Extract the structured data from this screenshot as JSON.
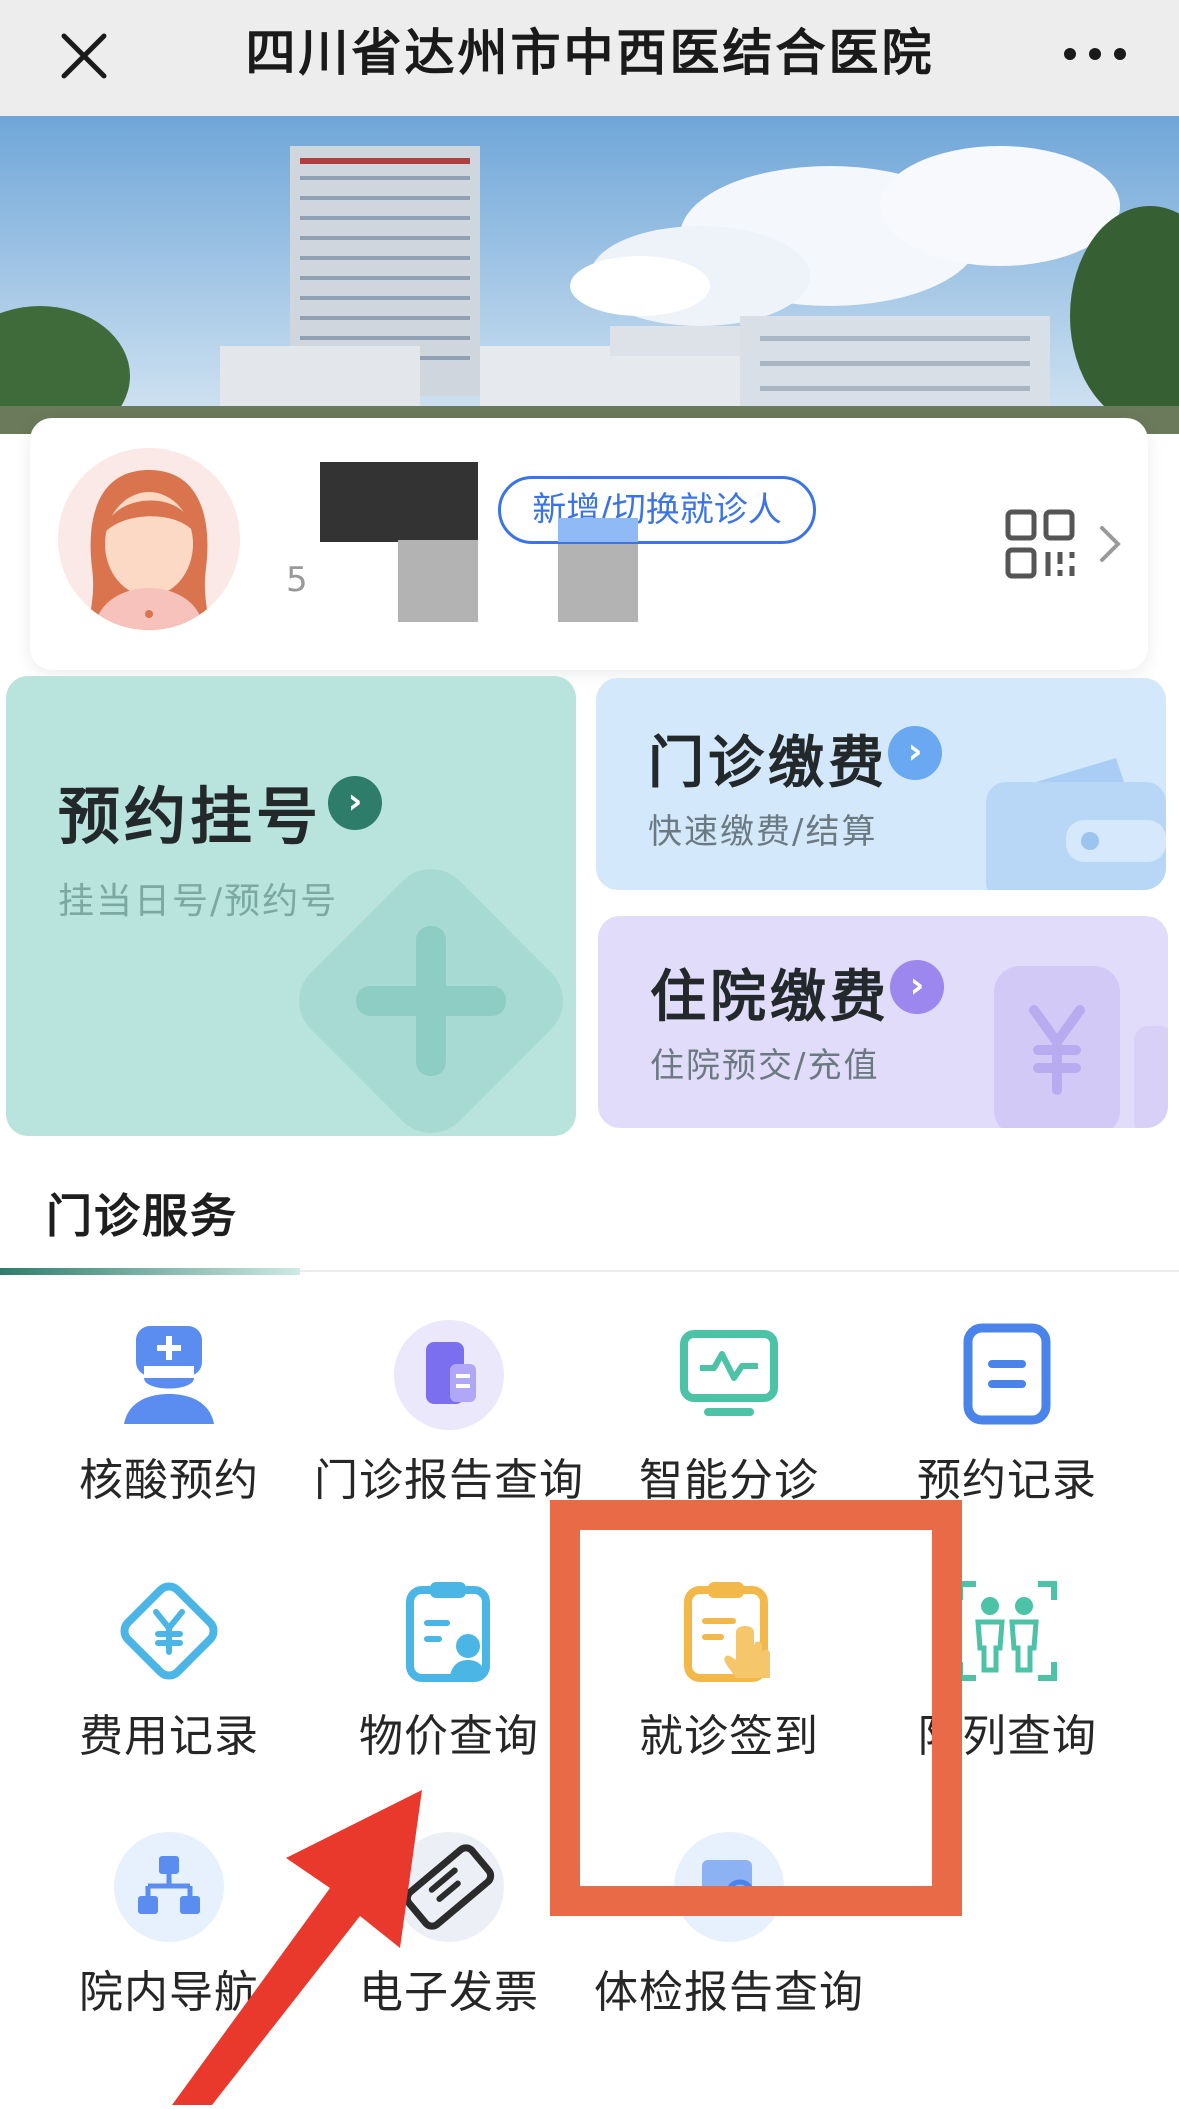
{
  "header": {
    "title": "四川省达州市中西医结合医院"
  },
  "patient_card": {
    "switch_label": "新增/切换就诊人",
    "id_fragment": "5"
  },
  "tiles": {
    "registration": {
      "title": "预约挂号",
      "subtitle": "挂当日号/预约号",
      "accent": "#2e7d6b"
    },
    "outpatient_pay": {
      "title": "门诊缴费",
      "subtitle": "快速缴费/结算",
      "accent": "#6aa9f2"
    },
    "inpatient_pay": {
      "title": "住院缴费",
      "subtitle": "住院预交/充值",
      "accent": "#9b87ee"
    }
  },
  "section": {
    "title": "门诊服务"
  },
  "services": [
    {
      "label": "核酸预约",
      "icon": "doctor-icon"
    },
    {
      "label": "门诊报告查询",
      "icon": "phone-report-icon"
    },
    {
      "label": "智能分诊",
      "icon": "monitor-icon"
    },
    {
      "label": "预约记录",
      "icon": "document-list-icon"
    },
    {
      "label": "费用记录",
      "icon": "yen-diamond-icon"
    },
    {
      "label": "物价查询",
      "icon": "clipboard-search-icon"
    },
    {
      "label": "就诊签到",
      "icon": "clipboard-tap-icon"
    },
    {
      "label": "队列查询",
      "icon": "people-queue-icon"
    },
    {
      "label": "院内导航",
      "icon": "sitemap-icon"
    },
    {
      "label": "电子发票",
      "icon": "ticket-icon"
    },
    {
      "label": "体检报告查询",
      "icon": "report-search-icon"
    }
  ],
  "colors": {
    "highlight": "#e86a47",
    "arrow": "#e8392c",
    "link": "#3b74e8"
  }
}
